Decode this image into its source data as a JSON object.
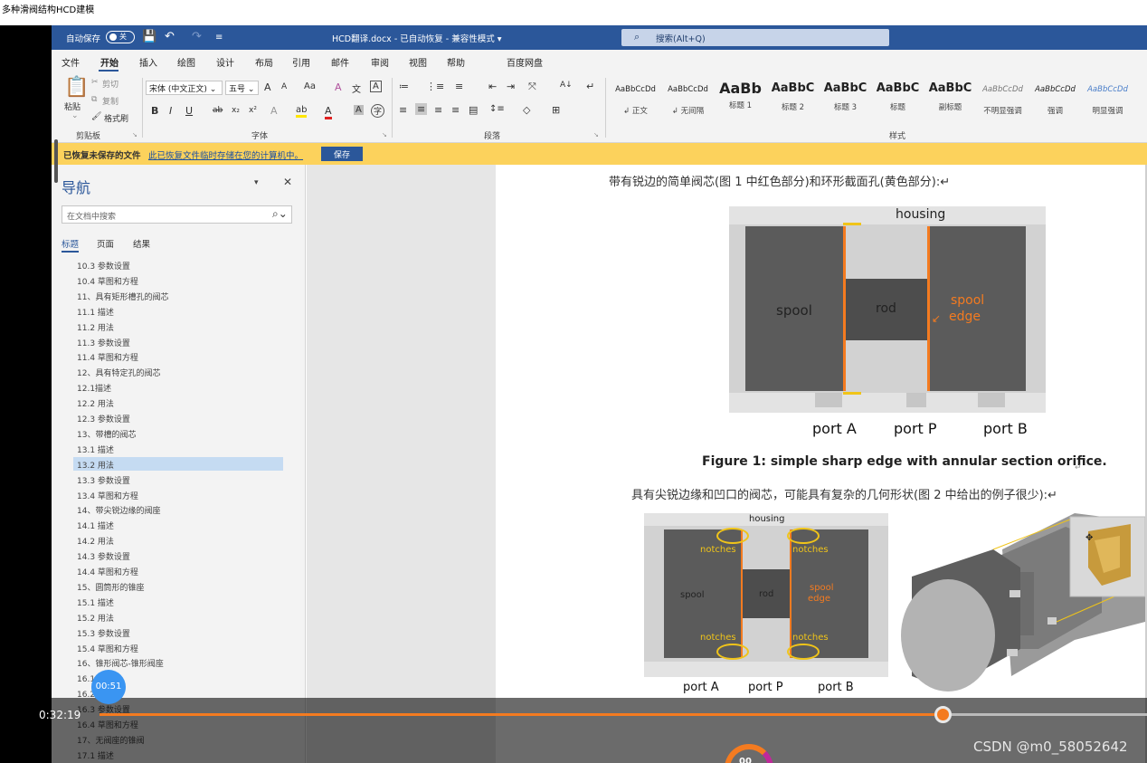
{
  "page_title": "多种滑阀结构HCD建模",
  "titlebar": {
    "autosave_label": "自动保存",
    "autosave_state": "关",
    "save_icon": "💾",
    "undo_icon": "↶",
    "redo_icon": "↷",
    "customize_icon": "≡",
    "doc_title": "HCD翻译.docx  -  已自动恢复  -  兼容性模式  ▾",
    "search_placeholder": "搜索(Alt+Q)"
  },
  "menu": [
    "文件",
    "开始",
    "插入",
    "绘图",
    "设计",
    "布局",
    "引用",
    "邮件",
    "审阅",
    "视图",
    "帮助",
    "百度网盘"
  ],
  "ribbon": {
    "paste": "粘贴",
    "cut": "剪切",
    "copy": "复制",
    "format_painter": "格式刷",
    "clipboard_group": "剪贴板",
    "font_name": "宋体 (中文正文)",
    "font_size": "五号",
    "grow_font": "A",
    "shrink_font": "A",
    "change_case": "Aa",
    "clear_format": "A",
    "phonetic": "文",
    "char_border": "A",
    "bold": "B",
    "italic": "I",
    "underline": "U",
    "strike": "ab",
    "subscript": "x₂",
    "superscript": "x²",
    "text_effect": "A",
    "highlight": "ab",
    "font_color": "A",
    "char_shade": "A",
    "enclose": "字",
    "font_group": "字体",
    "bullets": "≔",
    "numbering": "⋮≡",
    "multilevel": "≡",
    "dec_indent": "⇤",
    "inc_indent": "⇥",
    "chinese_layout": "⤧",
    "sort": "A↓",
    "show_marks": "↵",
    "align_left": "≡",
    "align_center": "≡",
    "align_right": "≡",
    "justify": "≡",
    "distribute": "▤",
    "line_spacing": "↕≡",
    "shading": "◇",
    "borders": "⊞",
    "paragraph_group": "段落",
    "styles_group": "样式",
    "styles": [
      {
        "preview": "AaBbCcDd",
        "name": "↲ 正文"
      },
      {
        "preview": "AaBbCcDd",
        "name": "↲ 无间隔"
      },
      {
        "preview": "AaBb",
        "name": "标题 1"
      },
      {
        "preview": "AaBbC",
        "name": "标题 2"
      },
      {
        "preview": "AaBbC",
        "name": "标题 3"
      },
      {
        "preview": "AaBbC",
        "name": "标题"
      },
      {
        "preview": "AaBbC",
        "name": "副标题"
      },
      {
        "preview": "AaBbCcDd",
        "name": "不明显强调"
      },
      {
        "preview": "AaBbCcDd",
        "name": "强调"
      },
      {
        "preview": "AaBbCcDd",
        "name": "明显强调"
      }
    ]
  },
  "infobar": {
    "bold": "已恢复未保存的文件",
    "message": "此已恢复文件临时存储在您的计算机中。",
    "save": "保存"
  },
  "nav": {
    "title": "导航",
    "search_placeholder": "在文档中搜索",
    "tabs": [
      "标题",
      "页面",
      "结果"
    ],
    "items": [
      "10.3 参数设置",
      "10.4 草图和方程",
      "11、具有矩形槽孔的阀芯",
      "11.1 描述",
      "11.2 用法",
      "11.3 参数设置",
      "11.4 草图和方程",
      "12、具有特定孔的阀芯",
      "12.1描述",
      "12.2 用法",
      "12.3 参数设置",
      "13、带槽的阀芯",
      "13.1 描述",
      "13.2 用法",
      "13.3 参数设置",
      "13.4 草图和方程",
      "14、带尖锐边缘的阀座",
      "14.1 描述",
      "14.2 用法",
      "14.3 参数设置",
      "14.4 草图和方程",
      "15、圆筒形的锥座",
      "15.1 描述",
      "15.2 用法",
      "15.3 参数设置",
      "15.4 草图和方程",
      "16、锥形阀芯-锥形阀座",
      "16.1 描述",
      "16.2 用法",
      "16.3 参数设置",
      "16.4 草图和方程",
      "17、无阀座的锥阀",
      "17.1 描述"
    ]
  },
  "document": {
    "para1": "带有锐边的简单阀芯(图 1 中红色部分)和环形截面孔(黄色部分):↵",
    "fig1": {
      "housing": "housing",
      "spool": "spool",
      "rod": "rod",
      "spool_edge_1": "spool",
      "spool_edge_2": "edge"
    },
    "ports": [
      "port A",
      "port P",
      "port B"
    ],
    "caption": "Figure 1: simple sharp edge with annular section orifice.",
    "para2": "具有尖锐边缘和凹口的阀芯，可能具有复杂的几何形状(图 2 中给出的例子很少):↵",
    "fig2": {
      "housing": "housing",
      "notches": "notches",
      "spool": "spool",
      "rod": "rod",
      "spool_edge_1": "spool",
      "spool_edge_2": "edge"
    },
    "ports2": [
      "port A",
      "port P",
      "port B"
    ]
  },
  "video": {
    "current_time": "0:32:19",
    "progress_fraction": 0.805,
    "timer": "00:51",
    "watermark": "CSDN @m0_58052642",
    "loader_text": "00"
  }
}
